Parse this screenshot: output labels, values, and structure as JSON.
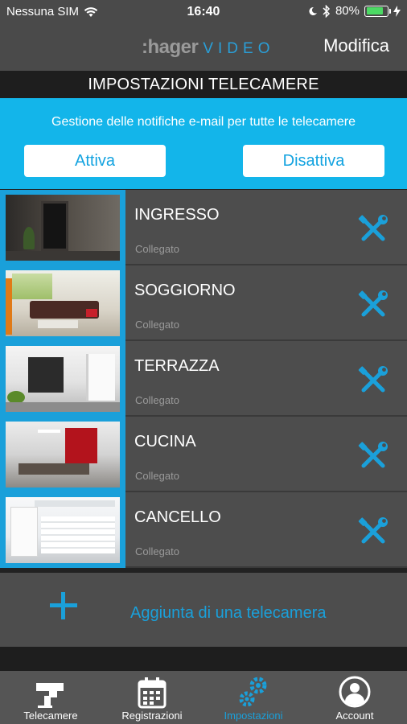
{
  "status_bar": {
    "carrier": "Nessuna SIM",
    "time": "16:40",
    "battery_percent": "80%",
    "battery_level": 0.8,
    "icons": [
      "wifi-icon",
      "moon-icon",
      "bluetooth-icon",
      "battery-icon",
      "charging-icon"
    ]
  },
  "nav": {
    "logo_brand": ":hager",
    "logo_product": "VIDEO",
    "action": "Modifica"
  },
  "section_title": "IMPOSTAZIONI TELECAMERE",
  "notifications": {
    "text": "Gestione delle notifiche e-mail per tutte le telecamere",
    "enable_label": "Attiva",
    "disable_label": "Disattiva"
  },
  "cameras": [
    {
      "name": "INGRESSO",
      "status": "Collegato",
      "icon": "wrench-screwdriver-icon"
    },
    {
      "name": "SOGGIORNO",
      "status": "Collegato",
      "icon": "wrench-screwdriver-icon"
    },
    {
      "name": "TERRAZZA",
      "status": "Collegato",
      "icon": "wrench-screwdriver-icon"
    },
    {
      "name": "CUCINA",
      "status": "Collegato",
      "icon": "wrench-screwdriver-icon"
    },
    {
      "name": "CANCELLO",
      "status": "Collegato",
      "icon": "wrench-screwdriver-icon"
    }
  ],
  "add_camera": {
    "label": "Aggiunta di una telecamera",
    "icon": "plus-icon"
  },
  "tabs": [
    {
      "label": "Telecamere",
      "icon": "camera-icon",
      "active": false
    },
    {
      "label": "Registrazioni",
      "icon": "calendar-icon",
      "active": false
    },
    {
      "label": "Impostazioni",
      "icon": "gears-icon",
      "active": true
    },
    {
      "label": "Account",
      "icon": "user-icon",
      "active": false
    }
  ],
  "colors": {
    "accent": "#1aa0da",
    "panel_blue": "#13b5ea",
    "row_bg": "#4d4d4d",
    "header_bg": "#1e1e1e",
    "bar_bg": "#4a4a4a",
    "battery_green": "#4cd964"
  }
}
